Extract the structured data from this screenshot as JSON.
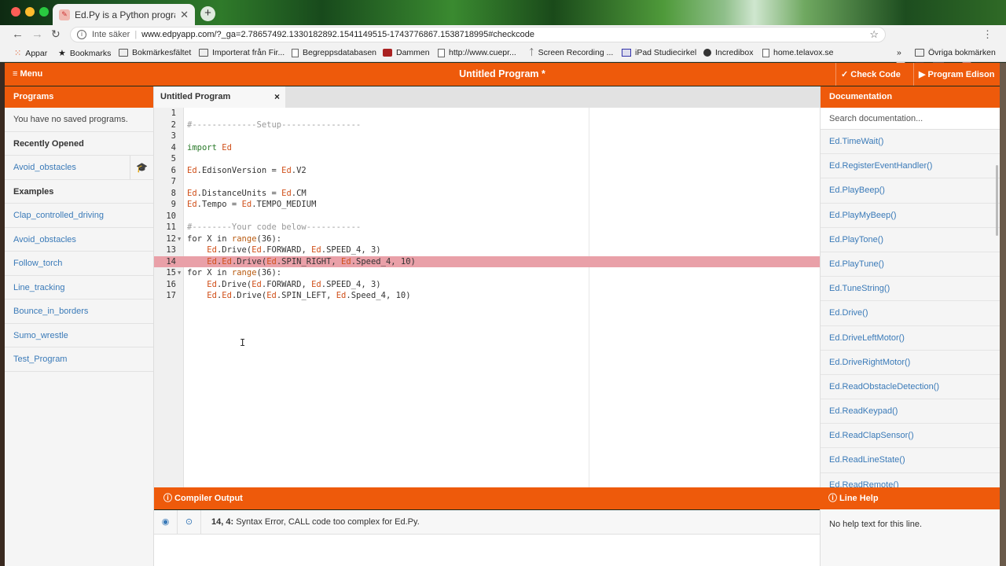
{
  "browser": {
    "tab_title": "Ed.Py is a Python programming",
    "new_tab": "+",
    "insecure_label": "Inte säker",
    "url": "www.edpyapp.com/?_ga=2.78657492.1330182892.1541149515-1743776867.1538718995#checkcode",
    "bookmarks": [
      {
        "label": "Appar",
        "icon": "apps-grid-icon"
      },
      {
        "label": "Bookmarks",
        "icon": "star-icon"
      },
      {
        "label": "Bokmärkesfältet",
        "icon": "folder-icon"
      },
      {
        "label": "Importerat från Fir...",
        "icon": "folder-icon"
      },
      {
        "label": "Begreppsdatabasen",
        "icon": "page-icon"
      },
      {
        "label": "Dammen",
        "icon": "site-icon"
      },
      {
        "label": "http://www.cuepr...",
        "icon": "page-icon"
      },
      {
        "label": "Screen Recording ...",
        "icon": "site-icon"
      },
      {
        "label": "iPad Studiecirkel",
        "icon": "site-icon"
      },
      {
        "label": "Incredibox",
        "icon": "site-icon"
      },
      {
        "label": "home.telavox.se",
        "icon": "page-icon"
      }
    ],
    "more_bookmarks": "»",
    "other_bookmarks": "Övriga bokmärken"
  },
  "app": {
    "menu_label": "≡ Menu",
    "title": "Untitled Program *",
    "check_code": "✓ Check Code",
    "program_edison": "▶ Program Edison"
  },
  "programs": {
    "header": "Programs",
    "no_saved": "You have no saved programs.",
    "recently_opened": "Recently Opened",
    "recent": [
      "Avoid_obstacles"
    ],
    "examples_header": "Examples",
    "examples": [
      "Clap_controlled_driving",
      "Avoid_obstacles",
      "Follow_torch",
      "Line_tracking",
      "Bounce_in_borders",
      "Sumo_wrestle",
      "Test_Program"
    ]
  },
  "editor": {
    "tab_label": "Untitled Program",
    "tab_close": "×",
    "error_line": 14,
    "lines": [
      {
        "n": "1",
        "text": ""
      },
      {
        "n": "2",
        "text": "#-------------Setup----------------"
      },
      {
        "n": "3",
        "text": ""
      },
      {
        "n": "4",
        "text": "import Ed"
      },
      {
        "n": "5",
        "text": ""
      },
      {
        "n": "6",
        "text": "Ed.EdisonVersion = Ed.V2"
      },
      {
        "n": "7",
        "text": ""
      },
      {
        "n": "8",
        "text": "Ed.DistanceUnits = Ed.CM"
      },
      {
        "n": "9",
        "text": "Ed.Tempo = Ed.TEMPO_MEDIUM"
      },
      {
        "n": "10",
        "text": ""
      },
      {
        "n": "11",
        "text": "#--------Your code below-----------"
      },
      {
        "n": "12",
        "text": "for X in range(36):"
      },
      {
        "n": "13",
        "text": "    Ed.Drive(Ed.FORWARD, Ed.SPEED_4, 3)"
      },
      {
        "n": "14",
        "text": "    Ed.Ed.Drive(Ed.SPIN_RIGHT, Ed.Speed_4, 10)"
      },
      {
        "n": "15",
        "text": "for X in range(36):"
      },
      {
        "n": "16",
        "text": "    Ed.Drive(Ed.FORWARD, Ed.SPEED_4, 3)"
      },
      {
        "n": "17",
        "text": "    Ed.Ed.Drive(Ed.SPIN_LEFT, Ed.Speed_4, 10)"
      }
    ]
  },
  "compiler": {
    "header": "ⓘ Compiler Output",
    "location": "14, 4:",
    "message": " Syntax Error, CALL code too complex for Ed.Py."
  },
  "documentation": {
    "header": "Documentation",
    "search_placeholder": "Search documentation...",
    "items": [
      "Ed.TimeWait()",
      "Ed.RegisterEventHandler()",
      "Ed.PlayBeep()",
      "Ed.PlayMyBeep()",
      "Ed.PlayTone()",
      "Ed.PlayTune()",
      "Ed.TuneString()",
      "Ed.Drive()",
      "Ed.DriveLeftMotor()",
      "Ed.DriveRightMotor()",
      "Ed.ReadObstacleDetection()",
      "Ed.ReadKeypad()",
      "Ed.ReadClapSensor()",
      "Ed.ReadLineState()",
      "Ed.ReadRemote()"
    ]
  },
  "line_help": {
    "header": "ⓘ Line Help",
    "text": "No help text for this line."
  },
  "colors": {
    "accent": "#ee5a0b",
    "link": "#3a7ab8",
    "error_line": "#e9a0a8"
  }
}
